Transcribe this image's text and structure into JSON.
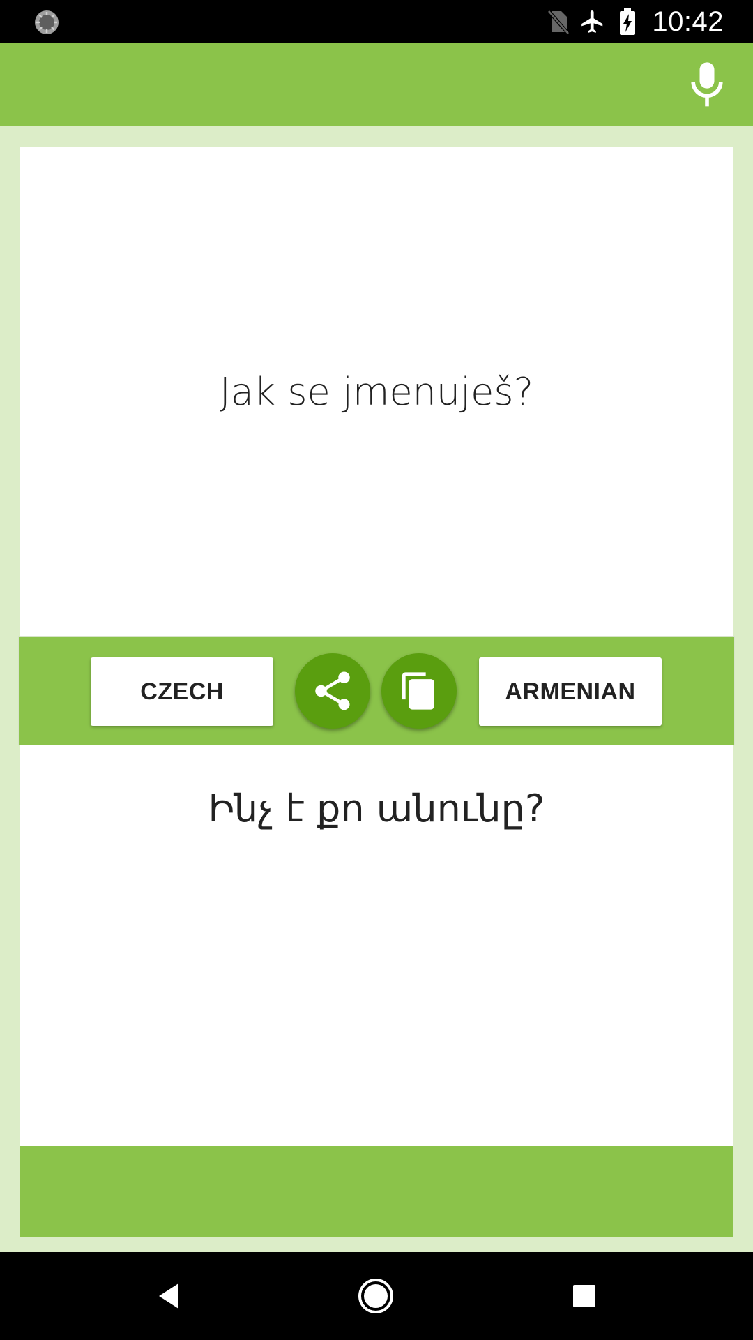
{
  "status_bar": {
    "time": "10:42",
    "left_icon": "loading-circle-icon",
    "icons": [
      "no-sim-icon",
      "airplane-mode-icon",
      "battery-charging-icon"
    ]
  },
  "app_bar": {
    "mic_icon": "microphone-icon",
    "color": "#8bc34a"
  },
  "translation": {
    "source_text": "Jak se jmenuješ?",
    "target_text": "Ինչ է քո անունը?"
  },
  "controls": {
    "source_language": "CZECH",
    "target_language": "ARMENIAN",
    "share_icon": "share-icon",
    "copy_icon": "copy-icon",
    "button_color": "#5a9e0f"
  },
  "navigation": {
    "back_icon": "back-icon",
    "home_icon": "home-icon",
    "recents_icon": "recents-icon"
  },
  "colors": {
    "accent": "#8bc34a",
    "background": "#dcedc8",
    "dark_accent": "#5a9e0f"
  }
}
